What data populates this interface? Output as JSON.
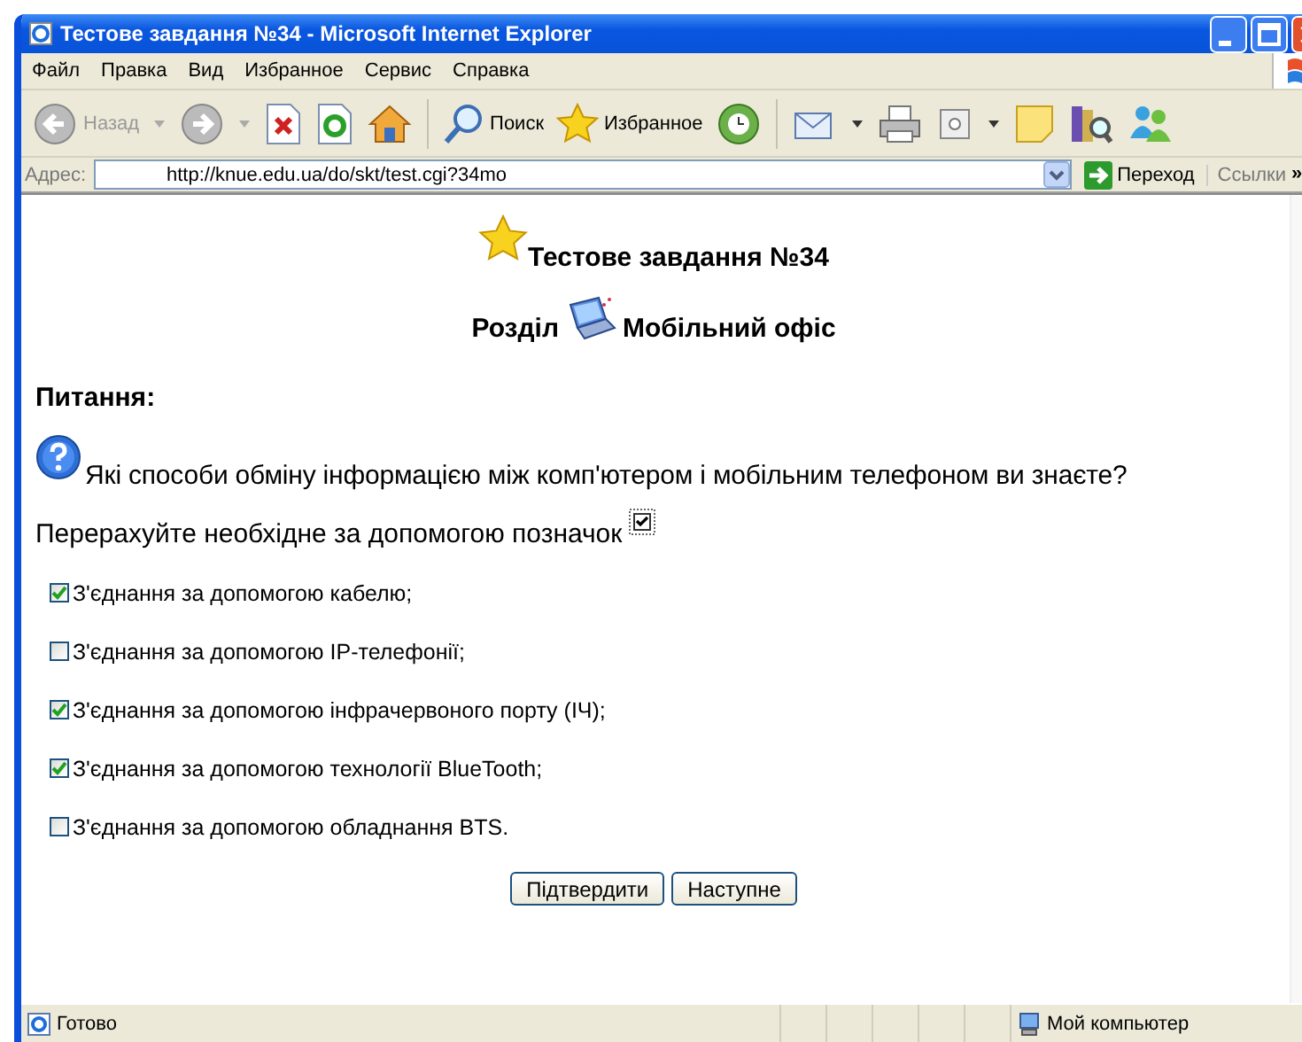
{
  "window": {
    "title": "Тестове завдання №34 - Microsoft Internet Explorer"
  },
  "menu": [
    "Файл",
    "Правка",
    "Вид",
    "Избранное",
    "Сервис",
    "Справка"
  ],
  "toolbar": {
    "back": "Назад",
    "search": "Поиск",
    "favorites": "Избранное"
  },
  "address_bar": {
    "label": "Адрес:",
    "value": "http://knue.edu.ua/do/skt/test.cgi?34mo",
    "go": "Переход",
    "links": "Ссылки",
    "more": "»"
  },
  "page": {
    "heading": "Тестове завдання №34",
    "section_label": "Розділ",
    "section_name": "Мобільний офіс",
    "question_label": "Питання:",
    "question": "Які способи обміну інформацією між комп'ютером і мобільним телефоном ви знаєте?",
    "instruction": "Перерахуйте необхідне за допомогою позначок",
    "options": [
      {
        "label": "З'єднання за допомогою кабелю;",
        "checked": true
      },
      {
        "label": "З'єднання за допомогою IP-телефонії;",
        "checked": false
      },
      {
        "label": "З'єднання за допомогою інфрачервоного порту (ІЧ);",
        "checked": true
      },
      {
        "label": "З'єднання за допомогою технології BlueTooth;",
        "checked": true
      },
      {
        "label": "З'єднання за допомогою обладнання BTS.",
        "checked": false
      }
    ],
    "buttons": [
      "Підтвердити",
      "Наступне"
    ]
  },
  "status_bar": {
    "text": "Готово",
    "zone": "Мой компьютер"
  }
}
